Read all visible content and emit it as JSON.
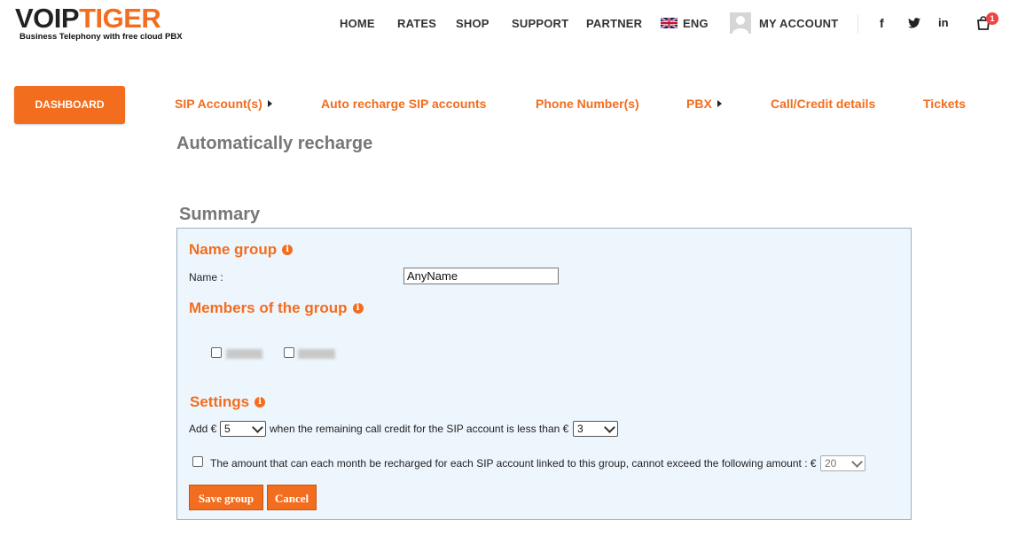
{
  "header": {
    "logo_part1": "VOIP",
    "logo_part2": "TIGER",
    "tagline": "Business Telephony with free cloud PBX",
    "nav": [
      "HOME",
      "RATES",
      "SHOP",
      "SUPPORT",
      "PARTNER"
    ],
    "language": "ENG",
    "language_flag": "uk-flag-icon",
    "account": "MY ACCOUNT",
    "social": [
      "facebook-icon",
      "twitter-icon",
      "linkedin-icon"
    ],
    "cart_count": "1"
  },
  "dashboard_label": "DASHBOARD",
  "menu": {
    "sip_accounts": "SIP Account(s)",
    "auto_recharge": "Auto recharge SIP accounts",
    "phone_numbers": "Phone Number(s)",
    "pbx": "PBX",
    "call_credit": "Call/Credit details",
    "tickets": "Tickets"
  },
  "page_title": "Automatically recharge",
  "summary_title": "Summary",
  "form": {
    "name_group_heading": "Name group",
    "name_label": "Name :",
    "name_value": "AnyName",
    "members_heading": "Members of the group",
    "settings_heading": "Settings",
    "add_prefix": "Add €",
    "add_amount": "5",
    "threshold_text": "when the remaining call credit for the SIP account is less than €",
    "threshold_value": "3",
    "monthly_limit_text": "The amount that can each month be recharged for each SIP account linked to this group, cannot exceed the following amount : €",
    "monthly_limit_value": "20",
    "save_button": "Save group",
    "cancel_button": "Cancel"
  },
  "colors": {
    "accent": "#f26d1e",
    "panel_bg": "#eef6fd",
    "panel_border": "#9bb0c4"
  }
}
